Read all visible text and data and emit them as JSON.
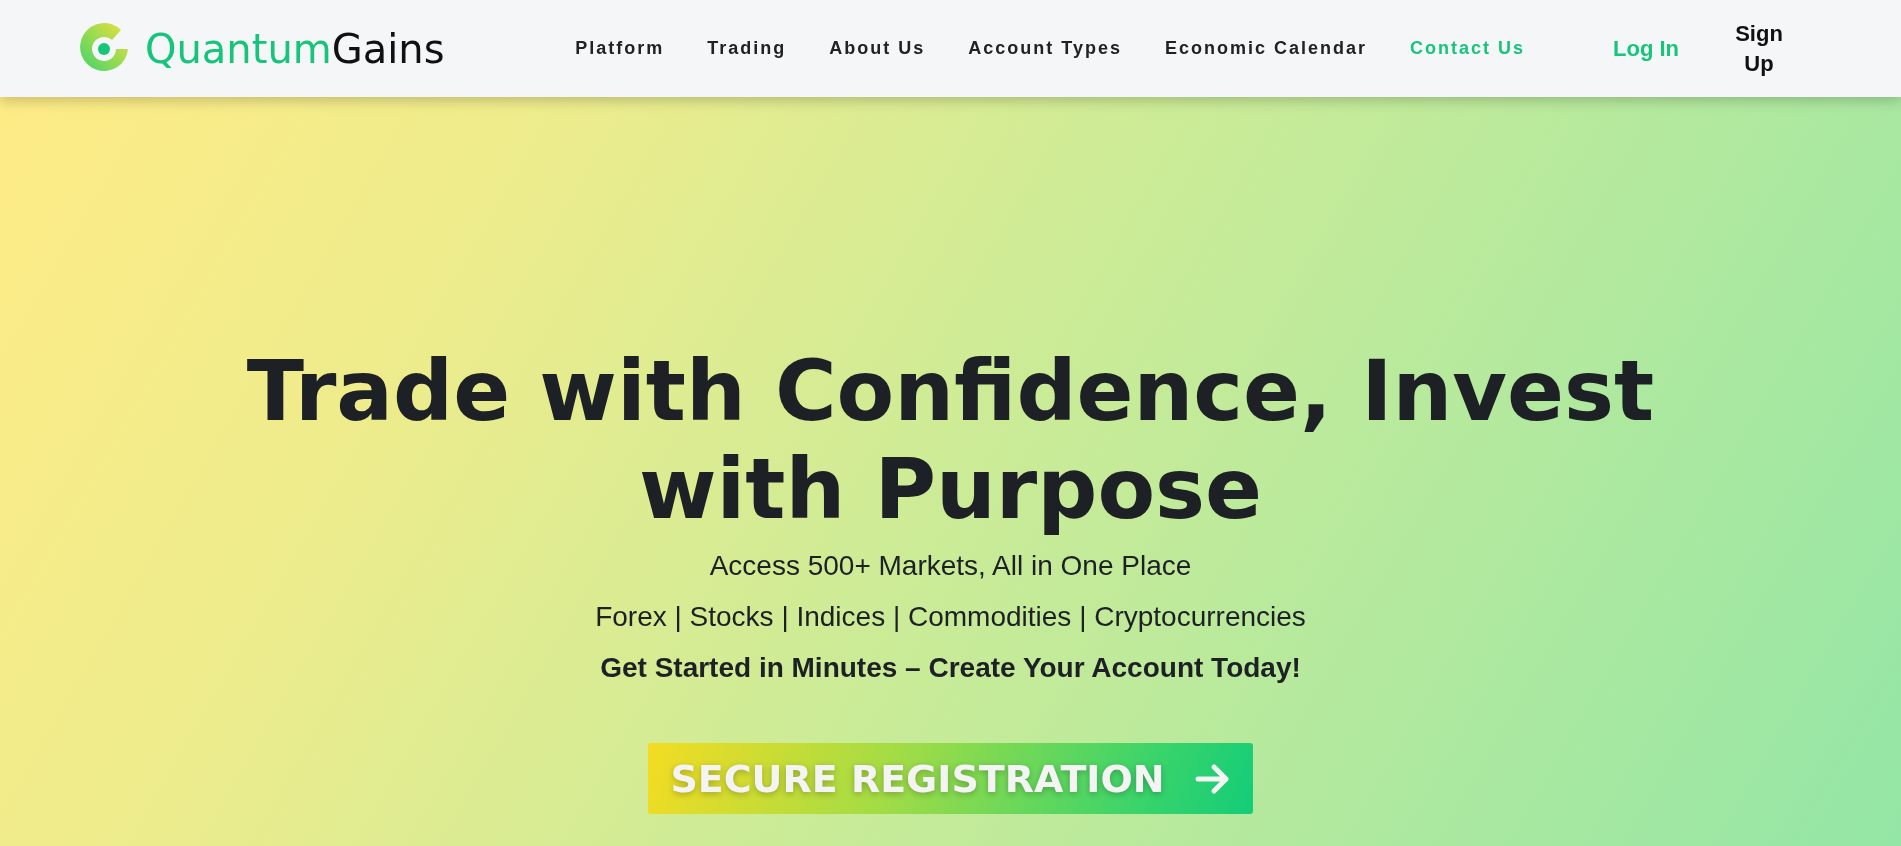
{
  "brand": {
    "name_first": "Quantum",
    "name_second": "Gains"
  },
  "nav": [
    {
      "label": "Platform",
      "selected": false
    },
    {
      "label": "Trading",
      "selected": false
    },
    {
      "label": "About Us",
      "selected": false
    },
    {
      "label": "Account Types",
      "selected": false
    },
    {
      "label": "Economic Calendar",
      "selected": false
    },
    {
      "label": "Contact Us",
      "selected": true
    }
  ],
  "auth": {
    "login": "Log In",
    "signup": "Sign Up"
  },
  "hero": {
    "title": "Trade with Confidence, Invest with Purpose",
    "subtitle": "Access 500+ Markets, All in One Place",
    "markets": "Forex | Stocks | Indices | Commodities | Cryptocurrencies",
    "cta_text": "Get Started in Minutes – Create Your Account Today!",
    "button": "SECURE REGISTRATION"
  }
}
